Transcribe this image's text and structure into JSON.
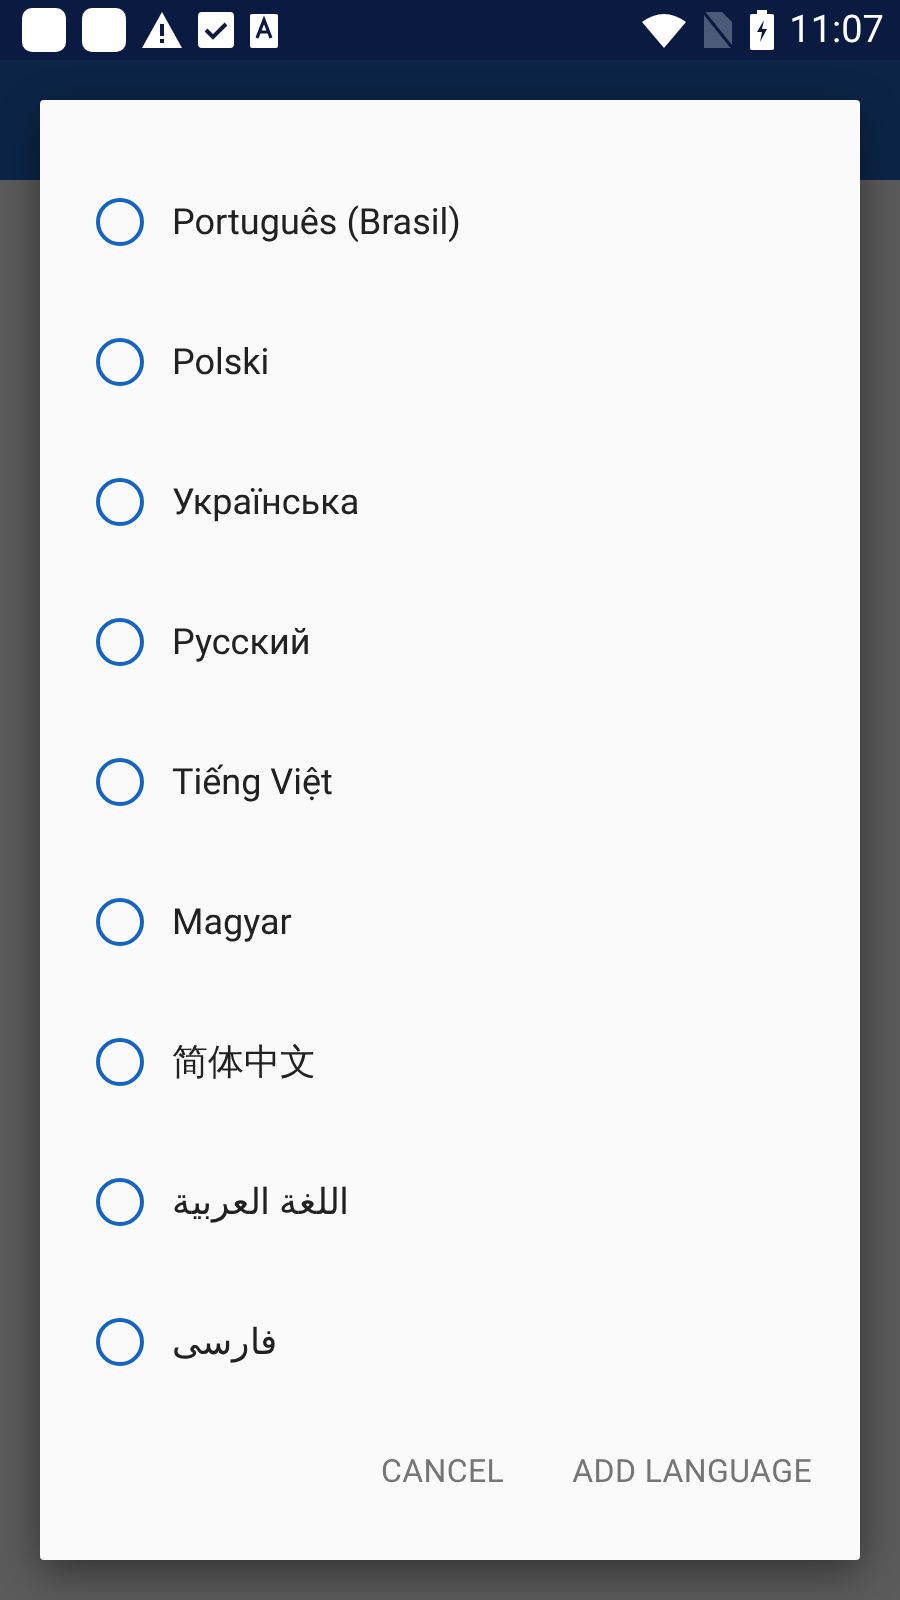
{
  "status_bar": {
    "time": "11:07"
  },
  "dialog": {
    "options": [
      {
        "label": "Português (Brasil)",
        "selected": false
      },
      {
        "label": "Polski",
        "selected": false
      },
      {
        "label": "Українська",
        "selected": false
      },
      {
        "label": "Русский",
        "selected": false
      },
      {
        "label": "Tiếng Việt",
        "selected": false
      },
      {
        "label": "Magyar",
        "selected": false
      },
      {
        "label": "简体中文",
        "selected": false
      },
      {
        "label": "اللغة العربية",
        "selected": false
      },
      {
        "label": "فارسی",
        "selected": false
      }
    ],
    "buttons": [
      "CANCEL",
      "ADD LANGUAGE"
    ]
  }
}
